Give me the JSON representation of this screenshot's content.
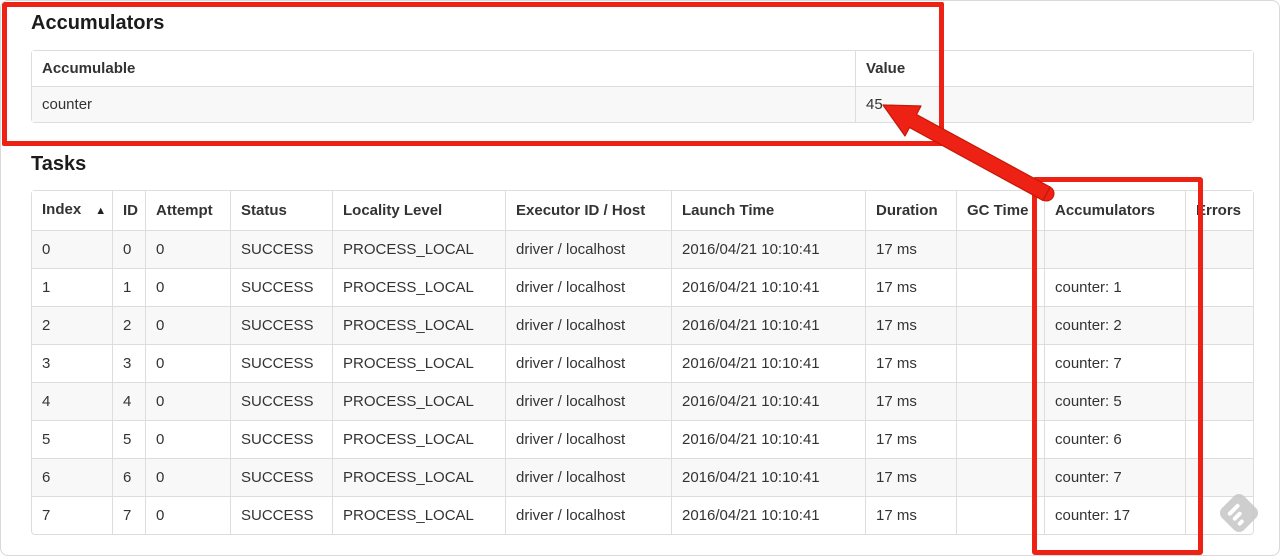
{
  "accumulators": {
    "heading": "Accumulators",
    "table": {
      "headers": [
        "Accumulable",
        "Value"
      ],
      "rows": [
        [
          "counter",
          "45"
        ]
      ]
    }
  },
  "tasks": {
    "heading": "Tasks",
    "table": {
      "headers": [
        "Index",
        "ID",
        "Attempt",
        "Status",
        "Locality Level",
        "Executor ID / Host",
        "Launch Time",
        "Duration",
        "GC Time",
        "Accumulators",
        "Errors"
      ],
      "sort_indicator": "▲",
      "rows": [
        {
          "index": "0",
          "id": "0",
          "attempt": "0",
          "status": "SUCCESS",
          "locality": "PROCESS_LOCAL",
          "executor": "driver / localhost",
          "launch_time": "2016/04/21 10:10:41",
          "duration": "17 ms",
          "gc_time": "",
          "accumulators": "",
          "errors": ""
        },
        {
          "index": "1",
          "id": "1",
          "attempt": "0",
          "status": "SUCCESS",
          "locality": "PROCESS_LOCAL",
          "executor": "driver / localhost",
          "launch_time": "2016/04/21 10:10:41",
          "duration": "17 ms",
          "gc_time": "",
          "accumulators": "counter: 1",
          "errors": ""
        },
        {
          "index": "2",
          "id": "2",
          "attempt": "0",
          "status": "SUCCESS",
          "locality": "PROCESS_LOCAL",
          "executor": "driver / localhost",
          "launch_time": "2016/04/21 10:10:41",
          "duration": "17 ms",
          "gc_time": "",
          "accumulators": "counter: 2",
          "errors": ""
        },
        {
          "index": "3",
          "id": "3",
          "attempt": "0",
          "status": "SUCCESS",
          "locality": "PROCESS_LOCAL",
          "executor": "driver / localhost",
          "launch_time": "2016/04/21 10:10:41",
          "duration": "17 ms",
          "gc_time": "",
          "accumulators": "counter: 7",
          "errors": ""
        },
        {
          "index": "4",
          "id": "4",
          "attempt": "0",
          "status": "SUCCESS",
          "locality": "PROCESS_LOCAL",
          "executor": "driver / localhost",
          "launch_time": "2016/04/21 10:10:41",
          "duration": "17 ms",
          "gc_time": "",
          "accumulators": "counter: 5",
          "errors": ""
        },
        {
          "index": "5",
          "id": "5",
          "attempt": "0",
          "status": "SUCCESS",
          "locality": "PROCESS_LOCAL",
          "executor": "driver / localhost",
          "launch_time": "2016/04/21 10:10:41",
          "duration": "17 ms",
          "gc_time": "",
          "accumulators": "counter: 6",
          "errors": ""
        },
        {
          "index": "6",
          "id": "6",
          "attempt": "0",
          "status": "SUCCESS",
          "locality": "PROCESS_LOCAL",
          "executor": "driver / localhost",
          "launch_time": "2016/04/21 10:10:41",
          "duration": "17 ms",
          "gc_time": "",
          "accumulators": "counter: 7",
          "errors": ""
        },
        {
          "index": "7",
          "id": "7",
          "attempt": "0",
          "status": "SUCCESS",
          "locality": "PROCESS_LOCAL",
          "executor": "driver / localhost",
          "launch_time": "2016/04/21 10:10:41",
          "duration": "17 ms",
          "gc_time": "",
          "accumulators": "counter: 17",
          "errors": ""
        }
      ]
    }
  },
  "annotations": {
    "accent_color": "#ee2214",
    "highlighted_value": "45",
    "highlighted_column": "Accumulators"
  },
  "watermark": {
    "icon": "annotation-tool-stamp",
    "color": "#c9c9c9"
  }
}
